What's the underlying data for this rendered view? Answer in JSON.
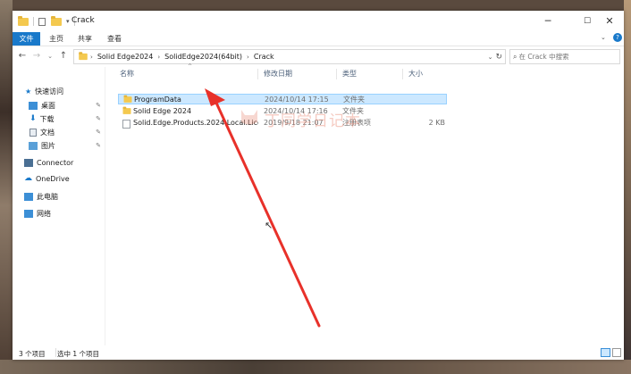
{
  "window": {
    "title": "Crack",
    "controls": {
      "minimize": "─",
      "maximize": "☐",
      "close": "✕"
    }
  },
  "ribbon": {
    "tabs": [
      "文件",
      "主页",
      "共享",
      "查看"
    ],
    "help": "?"
  },
  "address": {
    "crumbs": [
      "Solid Edge2024",
      "SolidEdge2024(64bit)",
      "Crack"
    ],
    "search_placeholder": "在 Crack 中搜索"
  },
  "nav": {
    "quick_access": "快速访问",
    "items": [
      "桌面",
      "下载",
      "文档",
      "图片"
    ],
    "connector": "Connector",
    "onedrive": "OneDrive",
    "this_pc": "此电脑",
    "network": "网络"
  },
  "columns": {
    "name": "名称",
    "date": "修改日期",
    "type": "类型",
    "size": "大小"
  },
  "files": [
    {
      "name": "ProgramData",
      "date": "2024/10/14 17:15",
      "type": "文件夹",
      "size": "",
      "kind": "folder"
    },
    {
      "name": "Solid Edge 2024",
      "date": "2024/10/14 17:16",
      "type": "文件夹",
      "size": "",
      "kind": "folder"
    },
    {
      "name": "Solid.Edge.Products.2024.Local.Licen...",
      "date": "2019/9/18 21:07",
      "type": "注册表项",
      "size": "2 KB",
      "kind": "reg"
    }
  ],
  "status": {
    "count": "3 个项目",
    "selected": "选中 1 个项目"
  },
  "watermark": "丁同学日记本",
  "colors": {
    "accent": "#1979ca",
    "selection": "#cce8ff",
    "arrow": "#e8312a",
    "folder": "#f4c94f"
  }
}
